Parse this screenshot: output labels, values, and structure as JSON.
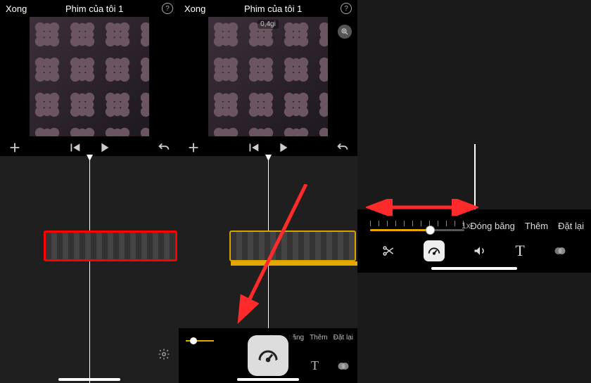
{
  "header": {
    "done": "Xong",
    "title": "Phim của tôi 1",
    "timecode": "0,4gi"
  },
  "speed": {
    "value_label": "1x",
    "freeze": "Đóng băng",
    "add": "Thêm",
    "reset": "Đặt lại"
  },
  "toolbar_mid": {
    "freeze": "Đóng băng",
    "add": "Thêm",
    "reset": "Đặt lại"
  },
  "colors": {
    "accent": "#e5a800",
    "highlight": "#ff0000",
    "annotation": "#ff2a2a"
  }
}
